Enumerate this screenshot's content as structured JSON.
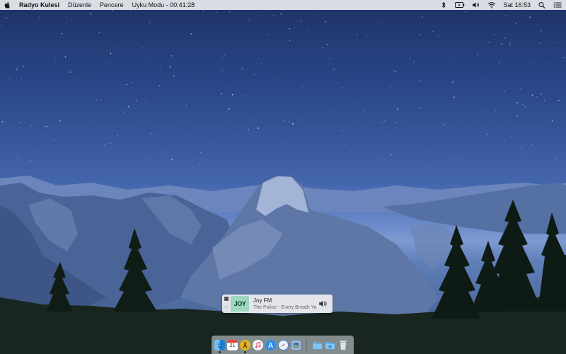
{
  "menubar": {
    "app_name": "Radyo Kulesi",
    "menus": [
      "Düzenle",
      "Pencere",
      "Uyku Modu - 00:41:28"
    ],
    "clock": "Sat 16:53",
    "status_icons": [
      "bluetooth-icon",
      "battery-icon",
      "volume-icon",
      "wifi-icon",
      "search-icon",
      "notification-center-icon"
    ]
  },
  "now_playing": {
    "logo_text": "JOY",
    "station": "Joy FM",
    "track": "The Police - Every Breath You Take"
  },
  "dock": {
    "apps": [
      "finder-icon",
      "calendar-icon",
      "radio-app-icon",
      "itunes-icon",
      "app-store-icon",
      "safari-icon",
      "preview-icon"
    ],
    "calendar_day": "21",
    "folders": [
      "folder-icon",
      "downloads-folder-icon",
      "trash-icon"
    ]
  },
  "colors": {
    "menubar": "#ececf0",
    "joy_logo": "#9cd7c0"
  }
}
